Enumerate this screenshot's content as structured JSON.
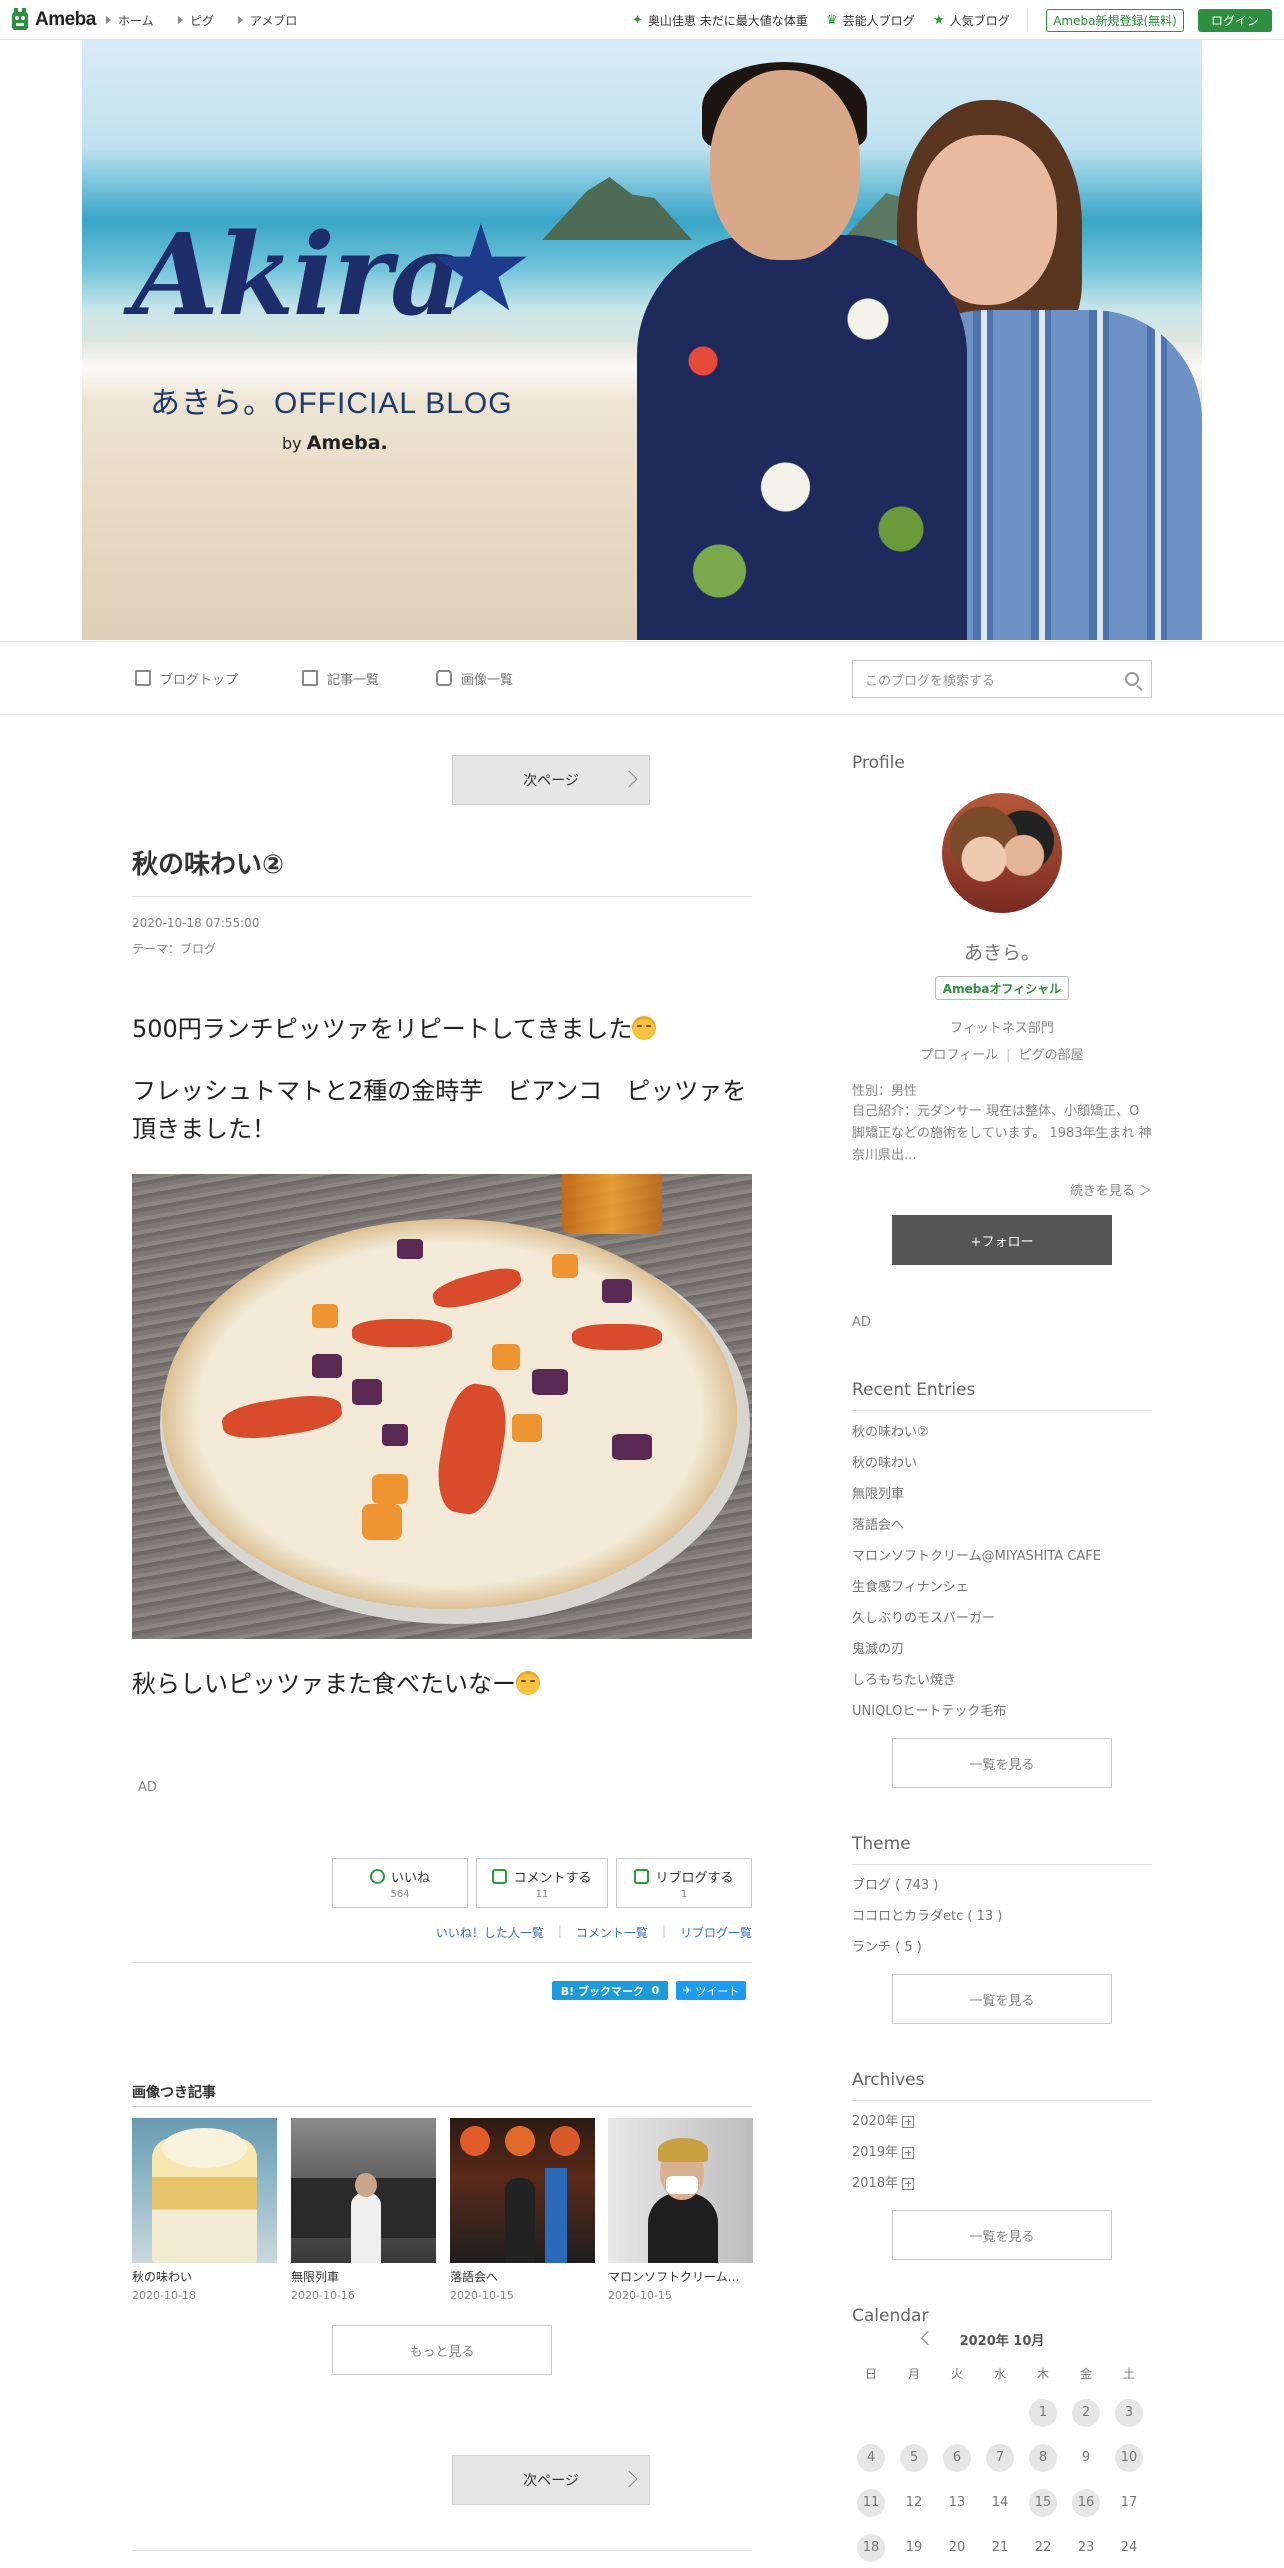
{
  "topbar": {
    "logo_text": "Ameba",
    "nav": [
      "ホーム",
      "ピグ",
      "アメブロ"
    ],
    "links": [
      {
        "icon": "sparkle-icon",
        "label": "奥山佳恵 未だに最大値な体重"
      },
      {
        "icon": "crown-icon",
        "label": "芸能人ブログ"
      },
      {
        "icon": "star-icon",
        "label": "人気ブログ"
      }
    ],
    "register_label": "Ameba新規登録(無料)",
    "login_label": "ログイン"
  },
  "header": {
    "logo_script": "Akira",
    "subtitle": "あきら。OFFICIAL BLOG",
    "by": "by",
    "by_brand": "Ameba."
  },
  "subnav": {
    "items": [
      "ブログトップ",
      "記事一覧",
      "画像一覧"
    ],
    "search_placeholder": "このブログを検索する"
  },
  "main": {
    "next_page_label": "次ページ",
    "entry": {
      "title": "秋の味わい②",
      "date": "2020-10-18 07:55:00",
      "theme_label": "テーマ：",
      "theme_value": "ブログ",
      "p1": "500円ランチピッツァをリピートしてきました",
      "p2": "フレッシュトマトと2種の金時芋　ビアンコ　ピッツァを頂きました！",
      "p3": "秋らしいピッツァまた食べたいなー"
    },
    "ad_label": "AD",
    "actions": [
      {
        "icon": "smile-icon",
        "label": "いいね",
        "count": "564"
      },
      {
        "icon": "comment-icon",
        "label": "コメントする",
        "count": "11"
      },
      {
        "icon": "reblog-icon",
        "label": "リブログする",
        "count": "1"
      }
    ],
    "action_links": [
      "いいね！した人一覧",
      "コメント一覧",
      "リブログ一覧"
    ],
    "hatena_label": "B! ブックマーク",
    "hatena_count": "0",
    "tweet_label": "ツイート",
    "image_entries_heading": "画像つき記事",
    "image_entries": [
      {
        "title": "秋の味わい",
        "date": "2020-10-18"
      },
      {
        "title": "無限列車",
        "date": "2020-10-16"
      },
      {
        "title": "落語会へ",
        "date": "2020-10-15"
      },
      {
        "title": "マロンソフトクリーム…",
        "date": "2020-10-15"
      }
    ],
    "more_label": "もっと見る"
  },
  "sidebar": {
    "profile": {
      "heading": "Profile",
      "name": "あきら。",
      "badge": "Amebaオフィシャル",
      "category": "フィットネス部門",
      "links": [
        "プロフィール",
        "ピグの部屋"
      ],
      "gender": "性別：男性",
      "intro": "自己紹介：元ダンサー 現在は整体、小顔矯正、O脚矯正などの施術をしています。 1983年生まれ 神奈川県出...",
      "more": "続きを見る ＞",
      "follow_label": "+フォロー"
    },
    "ad_label": "AD",
    "recent": {
      "heading": "Recent Entries",
      "items": [
        "秋の味わい②",
        "秋の味わい",
        "無限列車",
        "落語会へ",
        "マロンソフトクリーム@MIYASHITA CAFE",
        "生食感フィナンシェ",
        "久しぶりのモスバーガー",
        "鬼滅の刃",
        "しろもちたい焼き",
        "UNIQLOヒートテック毛布"
      ],
      "list_label": "一覧を見る"
    },
    "theme": {
      "heading": "Theme",
      "items": [
        "ブログ ( 743 )",
        "ココロとカラダetc ( 13 )",
        "ランチ ( 5 )"
      ],
      "list_label": "一覧を見る"
    },
    "archives": {
      "heading": "Archives",
      "items": [
        "2020年",
        "2019年",
        "2018年"
      ],
      "list_label": "一覧を見る"
    },
    "calendar": {
      "heading": "Calendar",
      "month": "2020年 10月",
      "weekdays": [
        "日",
        "月",
        "火",
        "水",
        "木",
        "金",
        "土"
      ],
      "rows": [
        [
          "",
          "",
          "",
          "",
          "1",
          "2",
          "3"
        ],
        [
          "4",
          "5",
          "6",
          "7",
          "8",
          "9",
          "10"
        ],
        [
          "11",
          "12",
          "13",
          "14",
          "15",
          "16",
          "17"
        ],
        [
          "18",
          "19",
          "20",
          "21",
          "22",
          "23",
          "24"
        ]
      ],
      "has_entry": [
        "1",
        "2",
        "3",
        "4",
        "5",
        "6",
        "7",
        "8",
        "10",
        "11",
        "15",
        "16",
        "18"
      ]
    }
  }
}
